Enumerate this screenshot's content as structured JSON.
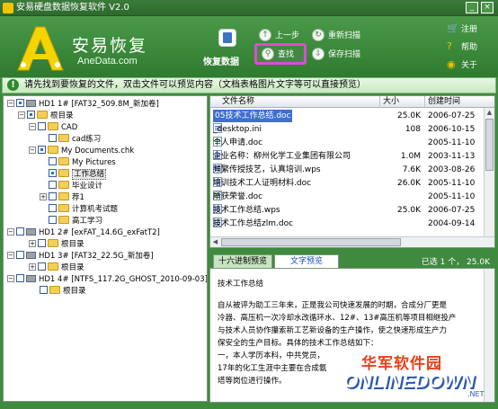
{
  "window": {
    "title": "安易硬盘数据恢复软件 V2.0"
  },
  "brand": {
    "name_cn": "安易恢复",
    "domain": "AneData.com"
  },
  "toolbar": {
    "recover_label": "恢复数据",
    "prev_label": "上一步",
    "rescan_label": "重新扫描",
    "search_label": "查找",
    "save_scan_label": "保存扫描"
  },
  "right_menu": {
    "register": "注册",
    "help": "帮助",
    "about": "关于"
  },
  "notice": "请先找到要恢复的文件，双击文件可以预览内容（文档表格图片文字等可以直接预览）",
  "tree": [
    {
      "label": "HD1  1# [FAT32_509.8M_新加卷]"
    },
    {
      "label": "根目录"
    },
    {
      "label": "CAD"
    },
    {
      "label": "cad练习"
    },
    {
      "label": "My Documents.chk"
    },
    {
      "label": "My Pictures"
    },
    {
      "label": "工作总结"
    },
    {
      "label": "毕业设计"
    },
    {
      "label": "荐1"
    },
    {
      "label": "计算机考试题"
    },
    {
      "label": "高工学习"
    },
    {
      "label": "HD1  2# [exFAT_14.6G_exFatT2]"
    },
    {
      "label": "根目录"
    },
    {
      "label": "HD1  3# [FAT32_22.5G_新加卷]"
    },
    {
      "label": "根目录"
    },
    {
      "label": "HD1  4# [NTFS_117.2G_GHOST_2010-09-03]"
    },
    {
      "label": "根目录"
    }
  ],
  "file_list": {
    "columns": [
      "文件名称",
      "大小",
      "创建时间"
    ],
    "rows": [
      {
        "name": "05技术工作总结.doc",
        "size": "25.0K",
        "date": "2006-07-25",
        "checked": true
      },
      {
        "name": "_desktop.ini",
        "size": "108",
        "date": "2006-10-15",
        "checked": false
      },
      {
        "name": "个人申请.doc",
        "size": "",
        "date": "2005-11-10",
        "checked": false
      },
      {
        "name": "企业名称：柳州化学工业集团有限公司",
        "size": "1.0M",
        "date": "2003-11-13",
        "checked": false
      },
      {
        "name": "频繁传授技艺，认真培训.wps",
        "size": "7.6K",
        "date": "2003-08-26",
        "checked": false
      },
      {
        "name": "培训技术工人证明材料.doc",
        "size": "26.0K",
        "date": "2005-11-10",
        "checked": false
      },
      {
        "name": "所获荣誉.doc",
        "size": "",
        "date": "2005-11-10",
        "checked": false
      },
      {
        "name": "技术工作总结.wps",
        "size": "25.0K",
        "date": "2006-07-25",
        "checked": false
      },
      {
        "name": "技术工作总结zlm.doc",
        "size": "",
        "date": "2004-09-14",
        "checked": false
      }
    ]
  },
  "preview": {
    "tab_hex": "十六进制预览",
    "tab_text": "文字预览",
    "selection_status": "已选 1 个， 25.0K",
    "title": "技术工作总结",
    "lines": [
      "自从被评为助工三年来，正是我公司快速发展的时期，合成分厂更是",
      "冷器、高压机一次冷却水改循环水、12#、13#高压机等项目相继投产",
      "与技术人员协作攥索新工艺新设备的生产操作，使之快速形成生产力",
      "保安全的生产目标。具体的技术工作总结如下：",
      "一，本人学历本科，中共党员，",
      "17年的化工生涯中主要在合成氨",
      "塔等岗位进行操作。"
    ]
  },
  "watermark": {
    "cn": "华军软件园",
    "en": "ONLINEDOWN",
    "suffix": ".NET"
  },
  "colors": {
    "frame": "#3f8a3f",
    "highlight": "#3e6fd1",
    "search_outline": "#d84fd0"
  }
}
